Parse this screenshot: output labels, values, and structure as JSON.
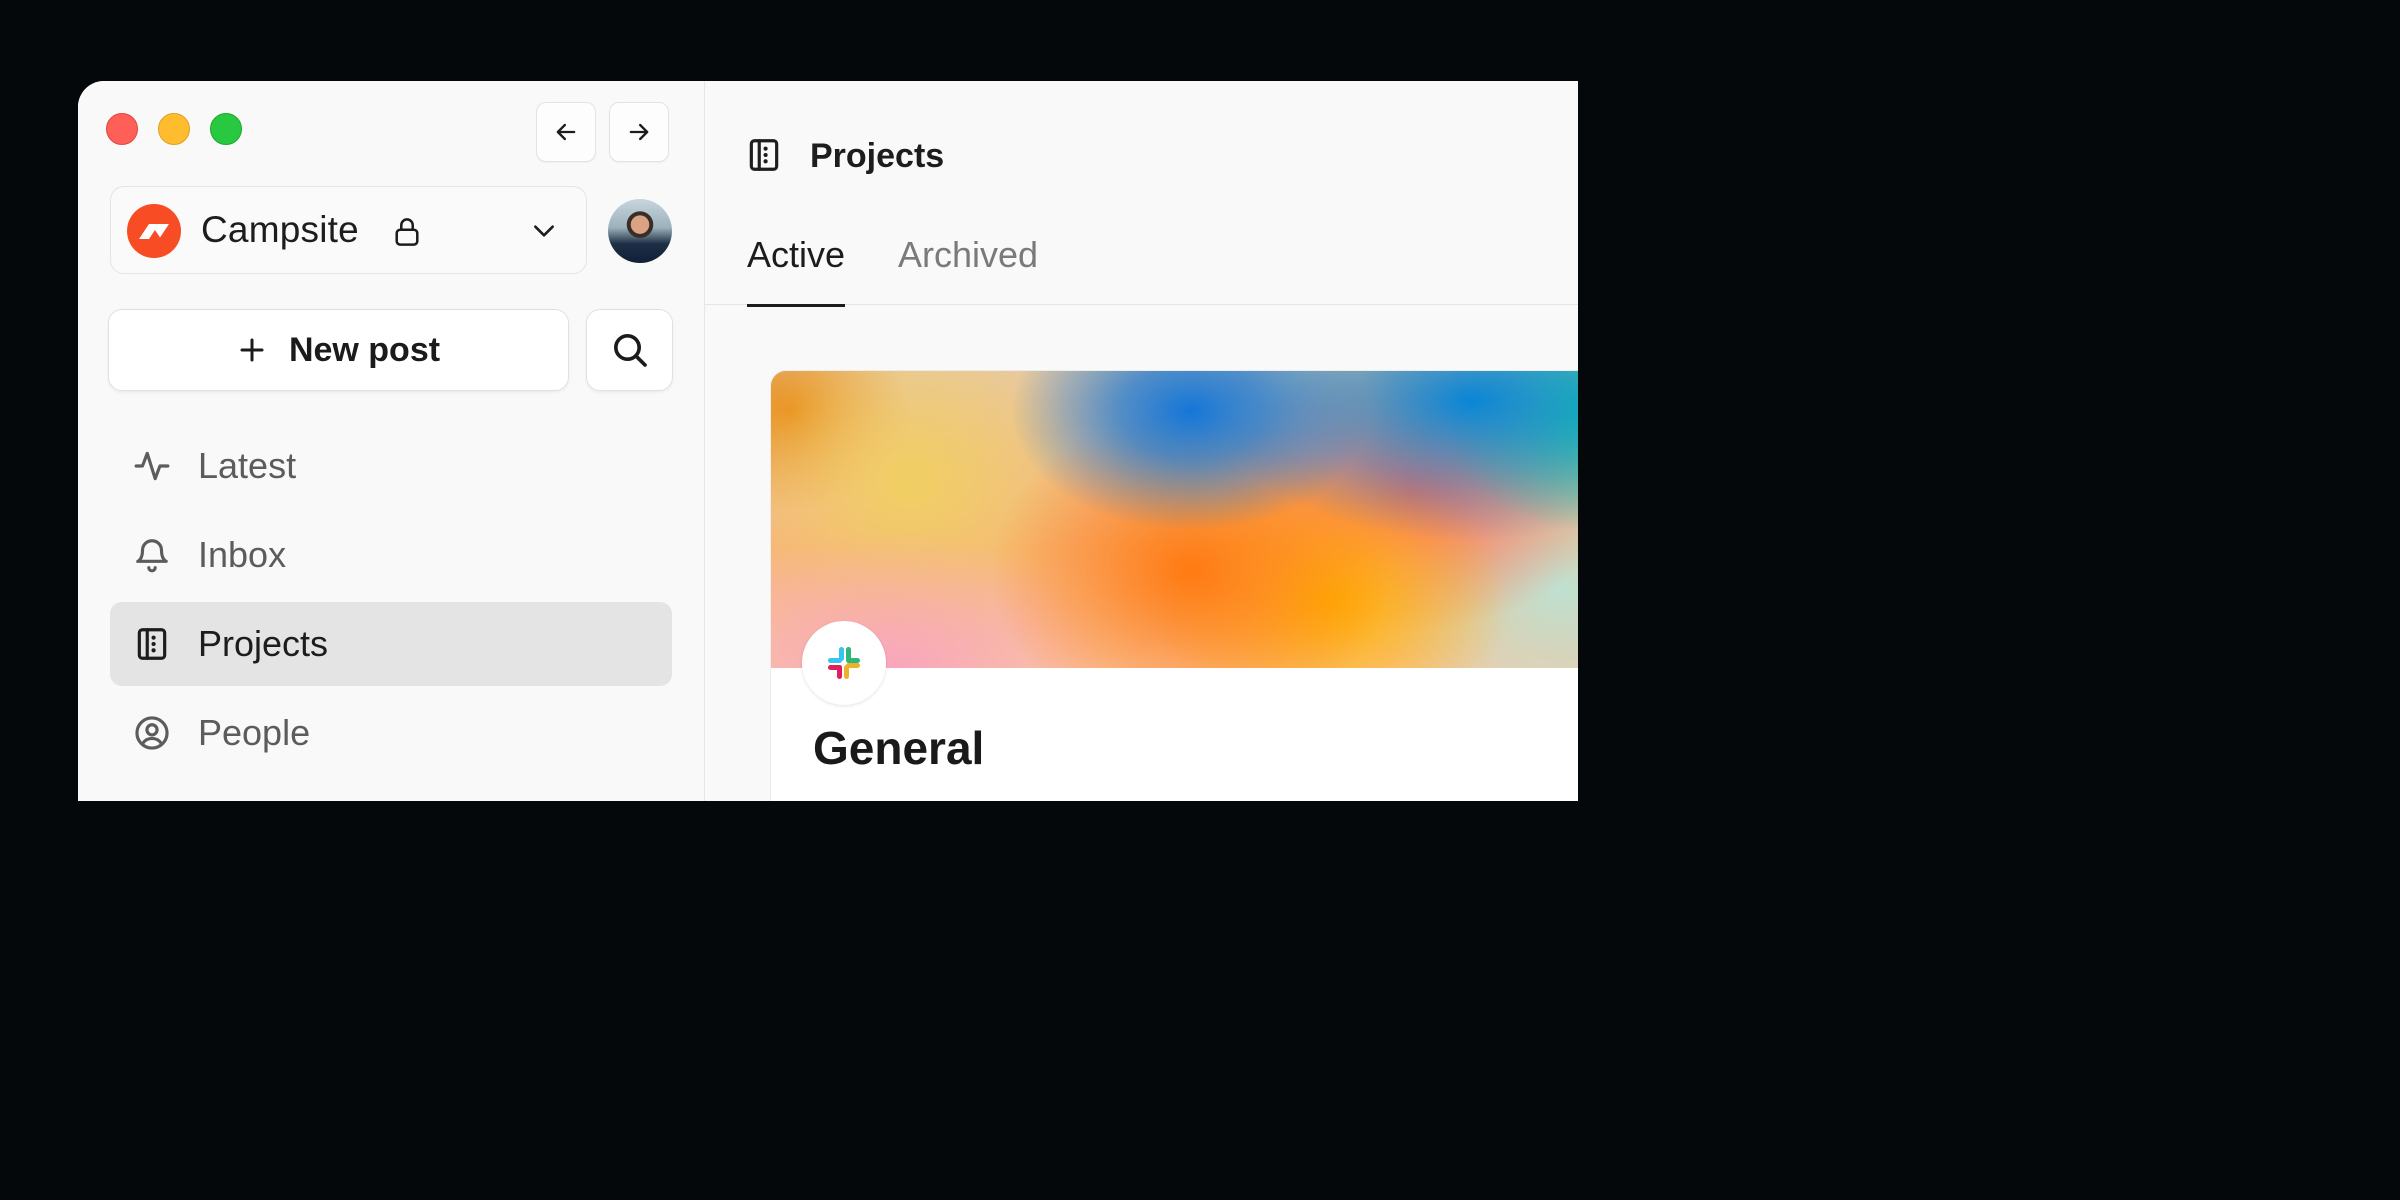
{
  "window": {
    "controls": [
      "close",
      "minimize",
      "zoom"
    ]
  },
  "sidebar": {
    "nav_back_icon": "arrow-left-icon",
    "nav_forward_icon": "arrow-right-icon",
    "org": {
      "name": "Campsite",
      "logo_color": "#f84d24",
      "private_icon": "lock-icon",
      "dropdown_icon": "chevron-down-icon"
    },
    "new_post_label": "New post",
    "search_icon": "search-icon",
    "items": [
      {
        "label": "Latest",
        "icon": "activity-icon",
        "active": false
      },
      {
        "label": "Inbox",
        "icon": "bell-icon",
        "active": false
      },
      {
        "label": "Projects",
        "icon": "notebook-icon",
        "active": true
      },
      {
        "label": "People",
        "icon": "user-circle-icon",
        "active": false
      }
    ]
  },
  "main": {
    "title": "Projects",
    "title_icon": "notebook-icon",
    "tabs": [
      {
        "label": "Active",
        "active": true
      },
      {
        "label": "Archived",
        "active": false
      }
    ],
    "project_card": {
      "name": "General",
      "logo_icon": "slack-logo-icon"
    }
  },
  "colors": {
    "background": "#05080b",
    "surface": "#f9f9f9",
    "active_item": "#e4e4e4",
    "traffic_red": "#fe5f57",
    "traffic_yellow": "#febc2e",
    "traffic_green": "#28c840"
  }
}
